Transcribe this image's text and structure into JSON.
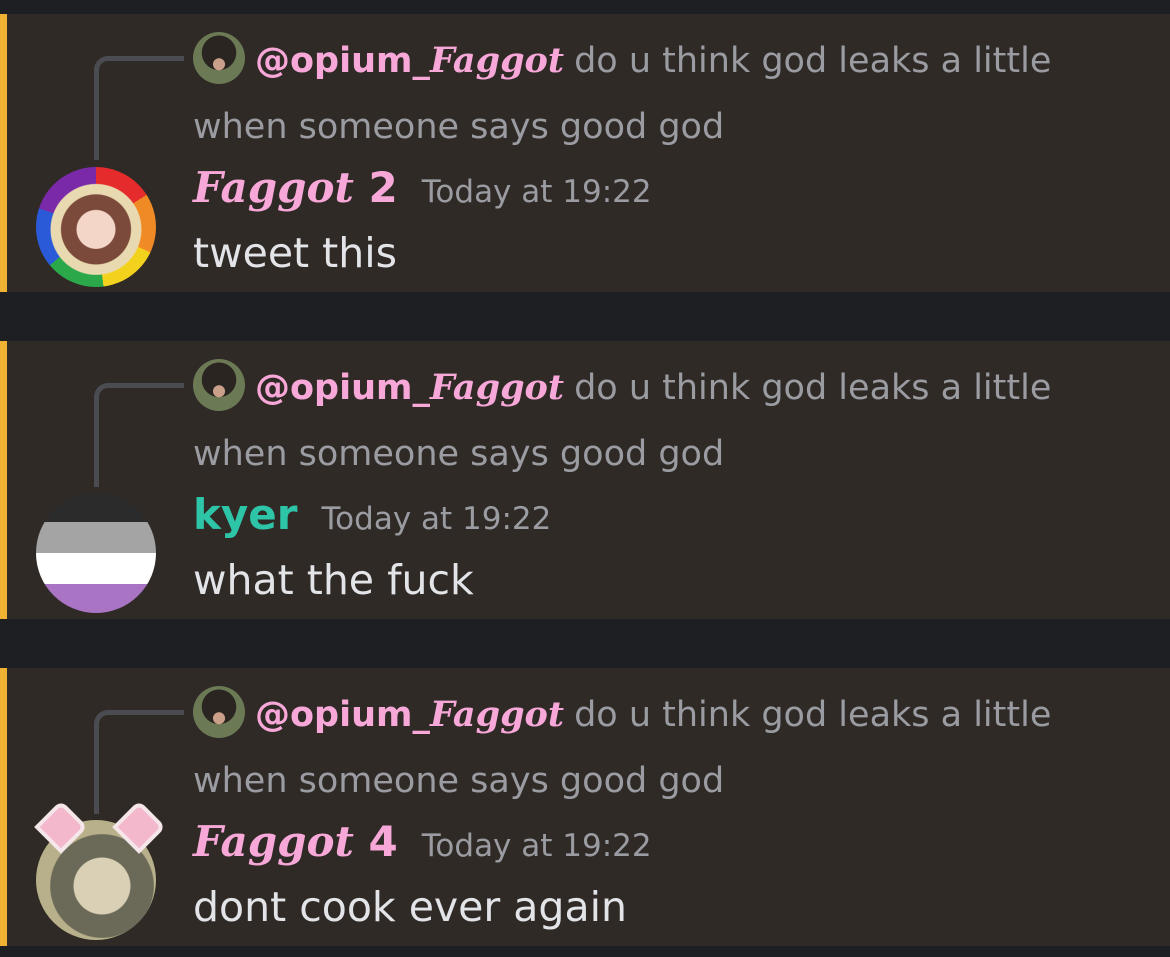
{
  "reply_preview": {
    "author": "@opium_",
    "author_fancy": "Faggot",
    "text": "do u think god leaks a little when someone says good god"
  },
  "messages": [
    {
      "username_fancy": "Faggot",
      "username_num": "2",
      "timestamp": "Today at 19:22",
      "content": "tweet this",
      "name_color": "#f7a8d8",
      "avatar_icon": "flower-crown-anime-avatar"
    },
    {
      "username": "kyer",
      "timestamp": "Today at 19:22",
      "content": "what the fuck",
      "name_color": "#2ec4a8",
      "avatar_icon": "asexual-flag-doodle-avatar"
    },
    {
      "username_fancy": "Faggot",
      "username_num": "4",
      "timestamp": "Today at 19:22",
      "content": "dont cook ever again",
      "name_color": "#f7a8d8",
      "avatar_icon": "cat-ear-anime-avatar"
    }
  ],
  "colors": {
    "background": "#1e1f22",
    "message_bg": "#2f2a26",
    "mention_accent": "#f0b232",
    "muted_text": "#9a9ca2",
    "body_text": "#e3e4e8"
  }
}
